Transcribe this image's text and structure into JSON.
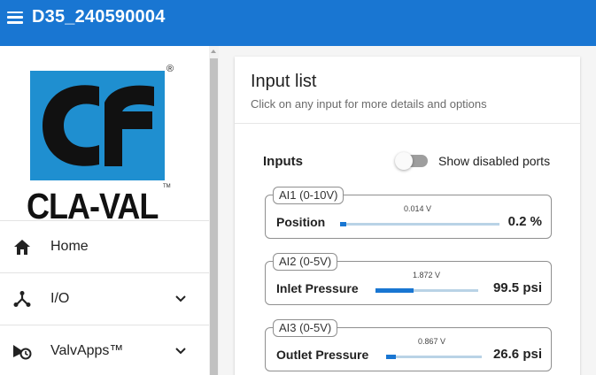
{
  "header": {
    "title": "D35_240590004",
    "menu_icon": "hamburger-menu-icon"
  },
  "brand": {
    "logo_text": "CLA-VAL",
    "registered_mark": "®",
    "trademark": "TM",
    "logo_color": "#1f8fd0"
  },
  "nav": [
    {
      "label": "Home",
      "icon": "home-icon",
      "expandable": false
    },
    {
      "label": "I/O",
      "icon": "io-network-icon",
      "expandable": true
    },
    {
      "label": "ValvApps™",
      "icon": "valvapps-clock-icon",
      "expandable": true
    }
  ],
  "panel": {
    "title": "Input list",
    "subtitle": "Click on any input for more details and options",
    "section_title": "Inputs",
    "toggle_label": "Show disabled ports",
    "toggle_on": false
  },
  "inputs": [
    {
      "tag": "AI1 (0-10V)",
      "name": "Position",
      "voltage": "0.014 V",
      "value": "0.2 %",
      "fill": 0.002
    },
    {
      "tag": "AI2 (0-5V)",
      "name": "Inlet Pressure",
      "voltage": "1.872 V",
      "value": "99.5 psi",
      "fill": 0.37
    },
    {
      "tag": "AI3 (0-5V)",
      "name": "Outlet Pressure",
      "voltage": "0.867 V",
      "value": "26.6 psi",
      "fill": 0.1
    }
  ],
  "colors": {
    "primary": "#1976d2",
    "track": "#b9d3e6",
    "background": "#f5f5f5"
  }
}
